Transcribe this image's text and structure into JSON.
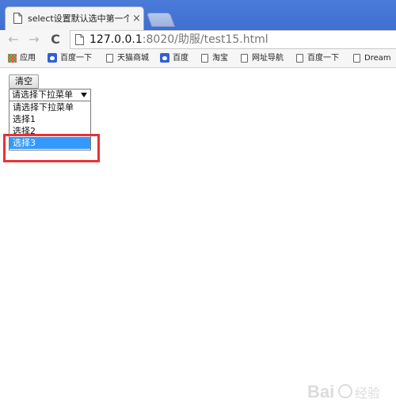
{
  "browser": {
    "tab_title": "select设置默认选中第一个",
    "tab_close": "×",
    "url_host": "127.0.0.1",
    "url_rest": ":8020/助服/test15.html"
  },
  "bookmarks": [
    {
      "label": "应用",
      "icon": "apps-icon"
    },
    {
      "label": "百度一下",
      "icon": "baidu-paw-icon"
    },
    {
      "label": "天猫商城",
      "icon": "page-icon"
    },
    {
      "label": "百度",
      "icon": "baidu-paw-icon"
    },
    {
      "label": "淘宝",
      "icon": "page-icon"
    },
    {
      "label": "网址导航",
      "icon": "page-icon"
    },
    {
      "label": "百度一下",
      "icon": "page-icon"
    },
    {
      "label": "Dream",
      "icon": "page-icon"
    }
  ],
  "page": {
    "clear_button": "清空",
    "select_value": "请选择下拉菜单",
    "options": [
      "请选择下拉菜单",
      "选择1",
      "选择2",
      "选择3"
    ],
    "selected_option": "选择3"
  },
  "annotation": {
    "highlight_color": "#e8313a"
  },
  "watermark": {
    "text": "Bai 经验"
  }
}
